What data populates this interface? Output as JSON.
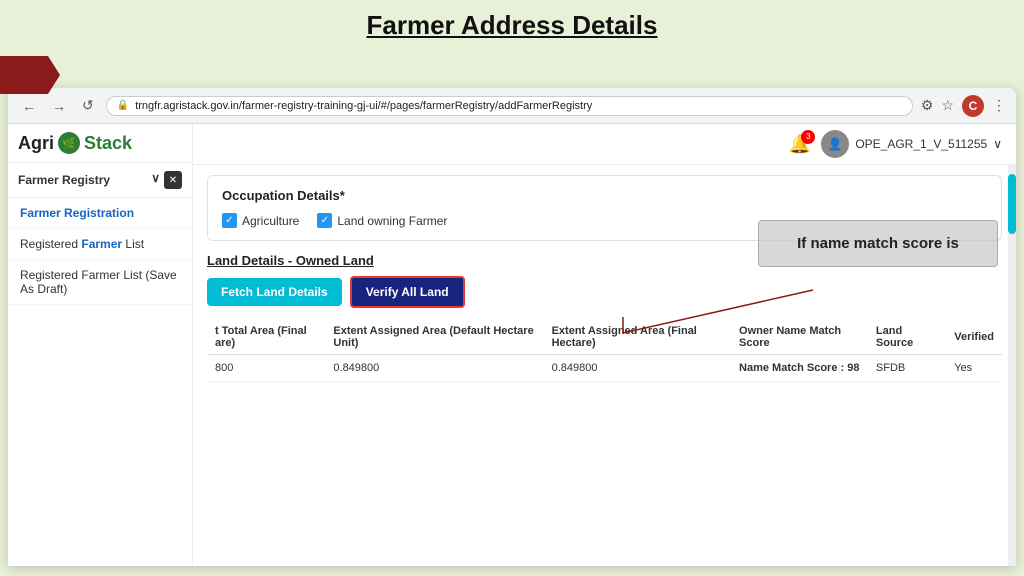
{
  "slide": {
    "title": "Farmer Address Details",
    "background_color": "#d8e8c8"
  },
  "browser": {
    "url": "trngfr.agristack.gov.in/farmer-registry-training-gj-ui/#/pages/farmerRegistry/addFarmerRegistry",
    "back_btn": "←",
    "forward_btn": "→",
    "refresh_btn": "↺"
  },
  "topbar": {
    "notification_count": "3",
    "user_name": "OPE_AGR_1_V_511255",
    "user_avatar_letter": "C"
  },
  "sidebar": {
    "logo_agri": "Agri",
    "logo_stack": "Stack",
    "section_label": "Farmer Registry",
    "collapse_btn": "✕",
    "nav_items": [
      {
        "label": "Farmer Registration",
        "active": true
      },
      {
        "label": "Registered Farmer List",
        "active": false
      },
      {
        "label": "Registered Farmer List (Save As Draft)",
        "active": false
      }
    ]
  },
  "occupation_section": {
    "title": "Occupation Details*",
    "checkboxes": [
      {
        "label": "Agriculture",
        "checked": true
      },
      {
        "label": "Land owning Farmer",
        "checked": true
      }
    ]
  },
  "land_section": {
    "title": "Land Details - Owned Land",
    "fetch_btn": "Fetch Land Details",
    "verify_btn": "Verify All Land",
    "table": {
      "headers": [
        "t Total Area (Final are)",
        "Extent Assigned Area (Default Hectare Unit)",
        "Extent Assigned Area (Final Hectare)",
        "Owner Name Match Score",
        "Land Source",
        "Verified"
      ],
      "rows": [
        {
          "total_area": "800",
          "extent_default": "0.849800",
          "extent_final": "0.849800",
          "name_match_score": "Name Match Score : 98",
          "land_source": "SFDB",
          "verified": "Yes"
        }
      ]
    }
  },
  "callout": {
    "text": "If name match score is"
  }
}
